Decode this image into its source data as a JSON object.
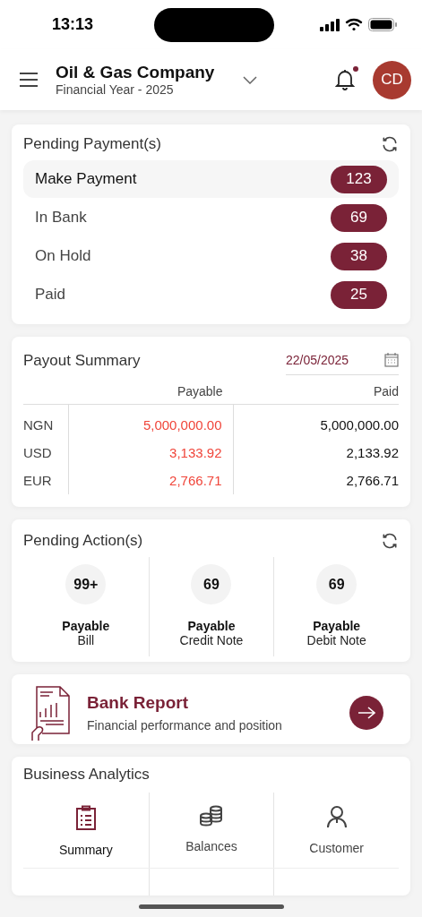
{
  "status_bar": {
    "time": "13:13"
  },
  "header": {
    "company": "Oil & Gas Company",
    "subtitle": "Financial Year - 2025",
    "has_notification": true,
    "avatar": "CD"
  },
  "pending_payments": {
    "title": "Pending Payment(s)",
    "items": [
      {
        "label": "Make Payment",
        "count": "123",
        "selected": true
      },
      {
        "label": "In Bank",
        "count": "69",
        "selected": false
      },
      {
        "label": "On Hold",
        "count": "38",
        "selected": false
      },
      {
        "label": "Paid",
        "count": "25",
        "selected": false
      }
    ]
  },
  "payout_summary": {
    "title": "Payout Summary",
    "date": "22/05/2025",
    "columns": [
      "Payable",
      "Paid"
    ],
    "rows": [
      {
        "currency": "NGN",
        "payable": "5,000,000.00",
        "paid": "5,000,000.00"
      },
      {
        "currency": "USD",
        "payable": "3,133.92",
        "paid": "2,133.92"
      },
      {
        "currency": "EUR",
        "payable": "2,766.71",
        "paid": "2,766.71"
      }
    ]
  },
  "pending_actions": {
    "title": "Pending Action(s)",
    "items": [
      {
        "count": "99+",
        "label": "Payable",
        "sublabel": "Bill"
      },
      {
        "count": "69",
        "label": "Payable",
        "sublabel": "Credit Note"
      },
      {
        "count": "69",
        "label": "Payable",
        "sublabel": "Debit Note"
      }
    ]
  },
  "bank_report": {
    "title": "Bank Report",
    "subtitle": "Financial performance and position"
  },
  "business_analytics": {
    "title": "Business Analytics",
    "items": [
      {
        "kind": "summary",
        "label": "Summary",
        "selected": true
      },
      {
        "kind": "balances",
        "label": "Balances",
        "selected": false
      },
      {
        "kind": "customer",
        "label": "Customer",
        "selected": false
      }
    ]
  }
}
